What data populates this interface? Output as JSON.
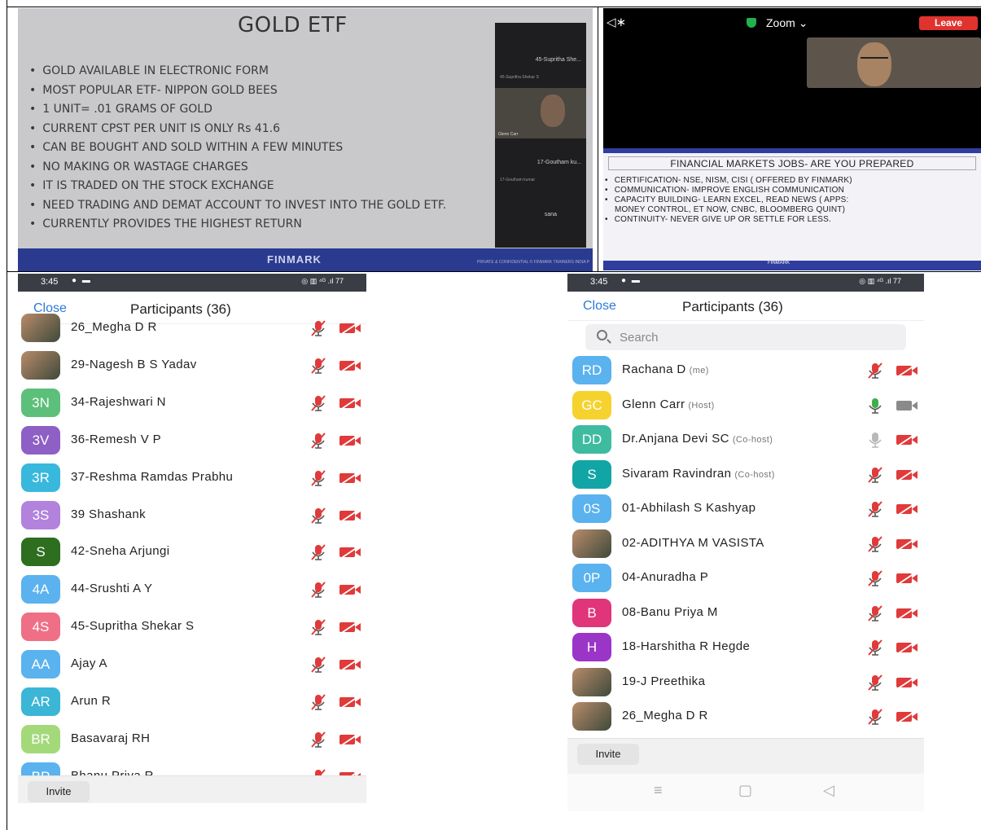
{
  "slide": {
    "title": "GOLD ETF",
    "bullets": [
      "GOLD AVAILABLE IN ELECTRONIC FORM",
      "MOST POPULAR ETF- NIPPON GOLD BEES",
      "1 UNIT= .01 GRAMS OF GOLD",
      "CURRENT CPST PER UNIT IS ONLY Rs 41.6",
      "CAN BE BOUGHT AND SOLD WITHIN A FEW MINUTES",
      "NO MAKING OR WASTAGE CHARGES",
      "IT IS TRADED ON THE STOCK EXCHANGE",
      "NEED  TRADING AND DEMAT ACCOUNT TO INVEST INTO THE GOLD ETF.",
      "CURRENTLY PROVIDES THE HIGHEST RETURN"
    ],
    "footer_brand": "FINMARK",
    "footer_conf": "PRIVATE & CONFIDENTIAL © FINMARK TRAINERS INDIA P",
    "strip": {
      "p1": "45-Supritha She...",
      "p1_sub": "45-Supritha Shekar S",
      "video_label": "Glenn Carr",
      "p2": "17-Goutham ku...",
      "p2_sub": "17-Goutham kumar",
      "p3": "sana"
    }
  },
  "zoom": {
    "title": "Zoom",
    "leave_label": "Leave",
    "share_title": "FINANCIAL MARKETS JOBS- ARE YOU PREPARED",
    "share_lines": [
      "CERTIFICATION- NSE, NISM, CISI ( OFFERED BY FINMARK)",
      "COMMUNICATION- IMPROVE ENGLISH COMMUNICATION",
      "CAPACITY BUILDING- LEARN EXCEL, READ NEWS ( APPS:",
      "MONEY CONTROL, ET NOW, CNBC, BLOOMBERG QUINT)",
      "CONTINUITY- NEVER GIVE UP OR SETTLE FOR LESS."
    ],
    "share_footer": "FINMARK"
  },
  "left_phone": {
    "time": "3:45",
    "battery": "77",
    "close_label": "Close",
    "title": "Participants (36)",
    "invite_label": "Invite",
    "rows": [
      {
        "initials": "",
        "name": "26_Megha D R",
        "color": "#c06080"
      },
      {
        "initials": "",
        "name": "29-Nagesh B S Yadav",
        "color": "#7a6a50"
      },
      {
        "initials": "3N",
        "name": "34-Rajeshwari N",
        "color": "#5cbf7a"
      },
      {
        "initials": "3V",
        "name": "36-Remesh V P",
        "color": "#8e5fc4"
      },
      {
        "initials": "3R",
        "name": "37-Reshma Ramdas Prabhu",
        "color": "#38b8dc"
      },
      {
        "initials": "3S",
        "name": "39 Shashank",
        "color": "#b282dc"
      },
      {
        "initials": "S",
        "name": "42-Sneha Arjungi",
        "color": "#2d6e1f"
      },
      {
        "initials": "4A",
        "name": "44-Srushti A Y",
        "color": "#5ab2ee"
      },
      {
        "initials": "4S",
        "name": "45-Supritha Shekar S",
        "color": "#ef6f86"
      },
      {
        "initials": "AA",
        "name": "Ajay A",
        "color": "#5ab2ee"
      },
      {
        "initials": "AR",
        "name": "Arun R",
        "color": "#3bb6d6"
      },
      {
        "initials": "BR",
        "name": "Basavaraj RH",
        "color": "#a4d97a"
      },
      {
        "initials": "BP",
        "name": "Bhanu Priya R",
        "color": "#5ab2ee"
      }
    ]
  },
  "right_phone": {
    "time": "3:45",
    "battery": "77",
    "close_label": "Close",
    "title": "Participants (36)",
    "search_placeholder": "Search",
    "invite_label": "Invite",
    "rows": [
      {
        "initials": "RD",
        "name": "Rachana D",
        "role": "(me)",
        "color": "#5ab2ee",
        "mic": "muted",
        "cam": "off"
      },
      {
        "initials": "GC",
        "name": "Glenn Carr",
        "role": "(Host)",
        "color": "#f6d22e",
        "mic": "on",
        "cam": "on"
      },
      {
        "initials": "DD",
        "name": "Dr.Anjana Devi SC",
        "role": "(Co-host)",
        "color": "#3fbba0",
        "mic": "idle",
        "cam": "off"
      },
      {
        "initials": "S",
        "name": "Sivaram Ravindran",
        "role": "(Co-host)",
        "color": "#12a5a5",
        "mic": "muted",
        "cam": "off"
      },
      {
        "initials": "0S",
        "name": "01-Abhilash S Kashyap",
        "role": "",
        "color": "#5ab2ee",
        "mic": "muted",
        "cam": "off"
      },
      {
        "initials": "",
        "name": "02-ADITHYA M VASISTA",
        "role": "",
        "color": "#c7b08a",
        "mic": "muted",
        "cam": "off"
      },
      {
        "initials": "0P",
        "name": "04-Anuradha P",
        "role": "",
        "color": "#5ab2ee",
        "mic": "muted",
        "cam": "off"
      },
      {
        "initials": "B",
        "name": "08-Banu Priya M",
        "role": "",
        "color": "#e0357a",
        "mic": "muted",
        "cam": "off"
      },
      {
        "initials": "H",
        "name": "18-Harshitha R Hegde",
        "role": "",
        "color": "#9b35c8",
        "mic": "muted",
        "cam": "off"
      },
      {
        "initials": "",
        "name": "19-J Preethika",
        "role": "",
        "color": "#b0855a",
        "mic": "muted",
        "cam": "off"
      },
      {
        "initials": "",
        "name": "26_Megha D R",
        "role": "",
        "color": "#c06080",
        "mic": "muted",
        "cam": "off"
      }
    ]
  },
  "colors": {
    "accent_blue": "#2d7ad6",
    "muted_red": "#e03a3a",
    "leave_red": "#e0332e",
    "mic_green": "#3fae49"
  }
}
